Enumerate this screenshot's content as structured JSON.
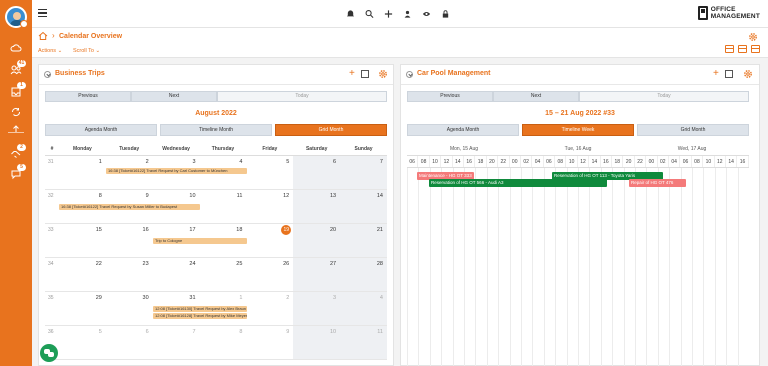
{
  "sidebar": {
    "items": [
      {
        "icon": "cloud-icon",
        "badge": ""
      },
      {
        "icon": "users-icon",
        "badge": "41"
      },
      {
        "icon": "inbox-icon",
        "badge": "1"
      },
      {
        "icon": "sync-icon",
        "badge": ""
      },
      {
        "icon": "upload-icon",
        "badge": ""
      },
      {
        "icon": "handshake-icon",
        "badge": "2"
      },
      {
        "icon": "chat-icon",
        "badge": "5"
      }
    ]
  },
  "brand": {
    "line1": "OFFICE",
    "line2": "MANAGEMENT"
  },
  "header": {
    "title": "Calendar Overview",
    "actions_label": "Actions",
    "scroll_label": "Scroll To"
  },
  "left_panel": {
    "title": "Business Trips",
    "nav": {
      "previous": "Previous",
      "next": "Next",
      "today": "Today"
    },
    "range": "August 2022",
    "views": [
      "Agenda Month",
      "Timeline Month",
      "Grid Month"
    ],
    "active_view": "Grid Month",
    "weekday_hash": "#",
    "weekdays": [
      "Monday",
      "Tuesday",
      "Wednesday",
      "Thursday",
      "Friday",
      "Saturday",
      "Sunday"
    ],
    "weeks": [
      {
        "num": "31",
        "days": [
          "1",
          "2",
          "3",
          "4",
          "5",
          "6",
          "7"
        ],
        "muted": [
          false,
          false,
          false,
          false,
          false,
          false,
          false
        ]
      },
      {
        "num": "32",
        "days": [
          "8",
          "9",
          "10",
          "11",
          "12",
          "13",
          "14"
        ],
        "muted": [
          false,
          false,
          false,
          false,
          false,
          false,
          false
        ]
      },
      {
        "num": "33",
        "days": [
          "15",
          "16",
          "17",
          "18",
          "19",
          "20",
          "21"
        ],
        "muted": [
          false,
          false,
          false,
          false,
          false,
          false,
          false
        ]
      },
      {
        "num": "34",
        "days": [
          "22",
          "23",
          "24",
          "25",
          "26",
          "27",
          "28"
        ],
        "muted": [
          false,
          false,
          false,
          false,
          false,
          false,
          false
        ]
      },
      {
        "num": "35",
        "days": [
          "29",
          "30",
          "31",
          "1",
          "2",
          "3",
          "4"
        ],
        "muted": [
          false,
          false,
          false,
          true,
          true,
          true,
          true
        ]
      },
      {
        "num": "36",
        "days": [
          "5",
          "6",
          "7",
          "8",
          "9",
          "10",
          "11"
        ],
        "muted": [
          true,
          true,
          true,
          true,
          true,
          true,
          true
        ]
      }
    ],
    "today_day": "19",
    "events": [
      {
        "text": "16:38 [Ticket#16122] Travel Request by Carl Customer to München"
      },
      {
        "text": "16:38 [Ticket#16122] Travel Request by Susan Miller to Budapest"
      },
      {
        "text": "Trip to Cologne"
      },
      {
        "text": "12:08 [Ticket#16130] Travel Request by Alex Braun"
      },
      {
        "text": "12:08 [Ticket#16128] Travel Request by Mike Meyer"
      }
    ]
  },
  "right_panel": {
    "title": "Car Pool Management",
    "nav": {
      "previous": "Previous",
      "next": "Next",
      "today": "Today"
    },
    "range": "15 – 21 Aug 2022 #33",
    "views": [
      "Agenda Month",
      "Timeline Week",
      "Grid Month"
    ],
    "active_view": "Timeline Week",
    "days": [
      "Mon, 15 Aug",
      "Tue, 16 Aug",
      "Wed, 17 Aug"
    ],
    "hours": [
      "06",
      "08",
      "10",
      "12",
      "14",
      "16",
      "18",
      "20",
      "22",
      "00",
      "02",
      "04",
      "06",
      "08",
      "10",
      "12",
      "14",
      "16",
      "18",
      "20",
      "22",
      "00",
      "02",
      "04",
      "06",
      "08",
      "10",
      "12",
      "14",
      "16"
    ],
    "bars": [
      {
        "text": "Maintenance - HG OT 333",
        "color": "#f47a7a"
      },
      {
        "text": "Reservation of HG OT 566 - Audi A3",
        "color": "#0f8a3c"
      },
      {
        "text": "Reservation of HG OT 113 - Toyota Yaris",
        "color": "#0f8a3c"
      },
      {
        "text": "Repair of HG OT 476",
        "color": "#f47a7a"
      }
    ]
  }
}
